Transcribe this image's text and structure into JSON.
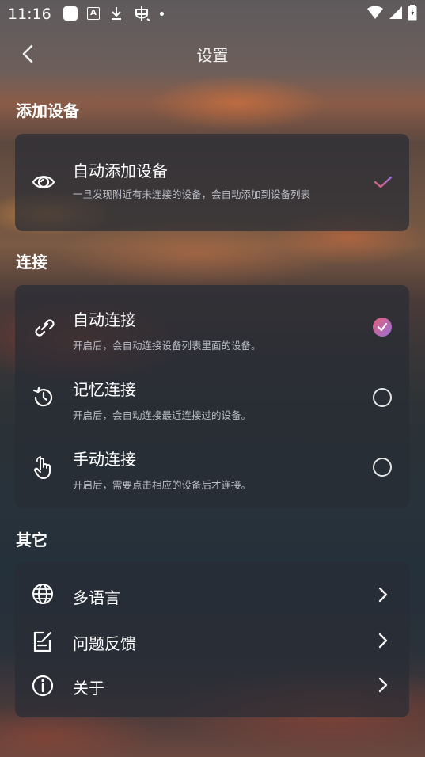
{
  "status_bar": {
    "time": "11:16",
    "left_icons": [
      "stop-square-icon",
      "a-input-icon",
      "download-icon",
      "bug-icon",
      "dot-icon"
    ],
    "right_icons": [
      "wifi-icon",
      "signal-icon",
      "battery-icon"
    ]
  },
  "header": {
    "title": "设置",
    "back_icon": "chevron-left-icon"
  },
  "sections": [
    {
      "title": "添加设备",
      "items": [
        {
          "title": "自动添加设备",
          "subtitle": "一旦发现附近有未连接的设备，会自动添加到设备列表",
          "icon": "eye-icon",
          "state": "checkmark"
        }
      ]
    },
    {
      "title": "连接",
      "items": [
        {
          "title": "自动连接",
          "subtitle": "开启后，会自动连接设备列表里面的设备。",
          "icon": "link-icon",
          "state": "selected"
        },
        {
          "title": "记忆连接",
          "subtitle": "开启后，会自动连接最近连接过的设备。",
          "icon": "history-icon",
          "state": "unselected"
        },
        {
          "title": "手动连接",
          "subtitle": "开启后，需要点击相应的设备后才连接。",
          "icon": "hand-tap-icon",
          "state": "unselected"
        }
      ]
    },
    {
      "title": "其它",
      "items": [
        {
          "title": "多语言",
          "icon": "globe-icon",
          "action": "chevron-right-icon"
        },
        {
          "title": "问题反馈",
          "icon": "feedback-edit-icon",
          "action": "chevron-right-icon"
        },
        {
          "title": "关于",
          "icon": "info-icon",
          "action": "chevron-right-icon"
        }
      ]
    }
  ],
  "colors": {
    "accent_gradient_start": "#e0607a",
    "accent_gradient_end": "#9a6fd8",
    "card_background": "rgba(40,44,52,0.72)",
    "subtitle_text": "#b8bcc4"
  }
}
